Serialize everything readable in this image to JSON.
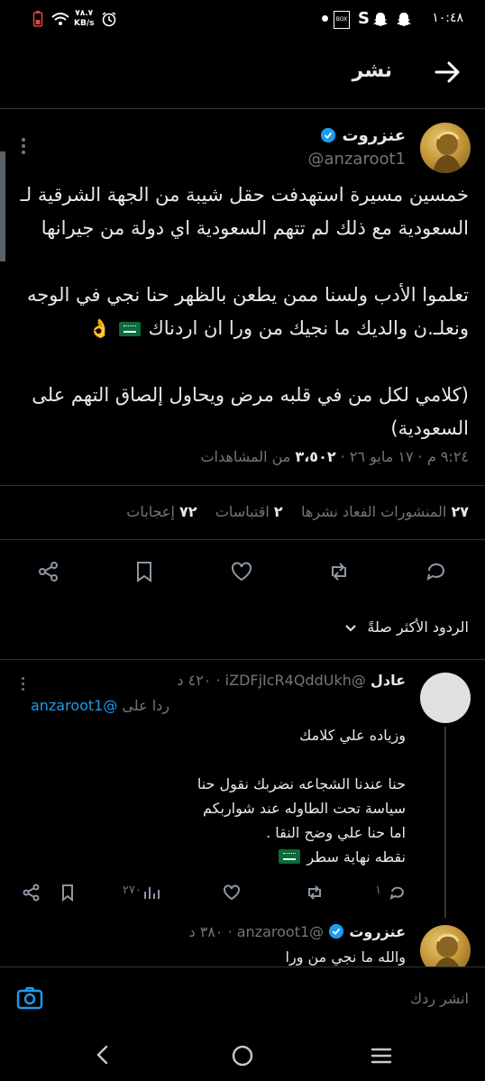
{
  "status_bar": {
    "time": "١٠:٤٨",
    "net_speed_value": "٧٨.٧",
    "net_speed_unit": "KB/s"
  },
  "header": {
    "title": "نشر"
  },
  "main_tweet": {
    "author_name": "عنزروت",
    "handle": "@anzaroot1",
    "text_lines": [
      "خمسين مسيرة استهدفت حقل شيبة من الجهة الشرقية لـ",
      "السعودية مع ذلك لم تتهم السعودية اي دولة من جيرانها",
      "",
      "تعلموا الأدب ولسنا ممن يطعن بالظهر حنا نجي في الوجه",
      "ونعلـ.ن والديك ما نجيك من ورا ان اردناك",
      "",
      "(كلامي لكل من في قلبه مرض ويحاول إلصاق التهم على",
      "السعودية)"
    ],
    "timestamp": "٩:٢٤ م · ١٧ مايو ٢٦ · ",
    "views_count": "٣،٥٠٢",
    "views_label": " من المشاهدات",
    "stats": {
      "quotes_count": "٢٧",
      "quotes_label": "المنشورات الفعاد نشرها",
      "reposts_count": "٢",
      "reposts_label": "اقتباسات",
      "likes_count": "٧٢",
      "likes_label": "إعجابات"
    }
  },
  "replies_sort": {
    "label": "الردود الأكثر صلةً"
  },
  "reply1": {
    "author_name": "عادل",
    "handle": "@iZDFjIcR4QddUkh",
    "age": "٤٢٠ د",
    "replying_to_prefix": "ردا على ",
    "replying_to_handle": "@anzaroot1",
    "text_lines": [
      "وزياده علي كلامك",
      "",
      "حنا عندنا الشجاعه نضربك نقول حنا",
      "سياسة تحت الطاوله عند شواربكم",
      "اما حنا علي وضح النقا .",
      "نقطه نهاية سطر"
    ],
    "reply_count": "١",
    "views": "٢٧٠"
  },
  "reply2": {
    "author_name": "عنزروت",
    "handle": "@anzaroot1",
    "age": "٣٨٠ د",
    "text_preview": "والله ما نجي من ورا"
  },
  "composer": {
    "placeholder": "انشر ردك"
  },
  "colors": {
    "accent": "#1d9bf0",
    "muted": "#71767b",
    "verified": "#1d9bf0",
    "divider": "#2f3336"
  }
}
